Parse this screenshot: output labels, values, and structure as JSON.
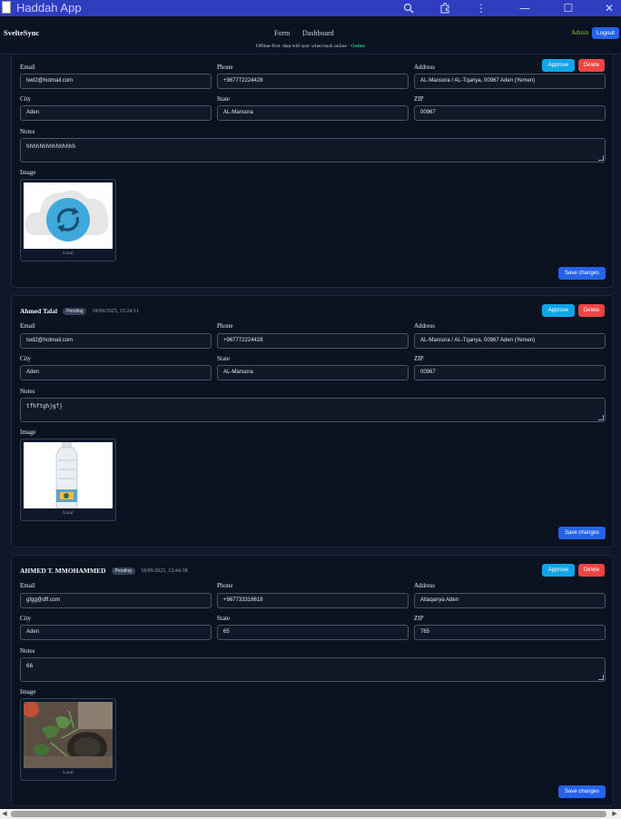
{
  "window": {
    "title": "Haddah App"
  },
  "navbar": {
    "brand": "SvelteSync",
    "links": [
      "Form",
      "Dashboard"
    ],
    "admin_label": "Admin",
    "logout_label": "Logout",
    "status_text": "Offline-first: data will sync when back online ·",
    "status_state": "Online"
  },
  "labels": {
    "email": "Email",
    "phone": "Phone",
    "address": "Address",
    "city": "City",
    "state": "State",
    "zip": "ZIP",
    "notes": "Notes",
    "image": "Image",
    "image_source": "Local",
    "approve": "Approve",
    "delete": "Delete",
    "save": "Save changes"
  },
  "records": [
    {
      "name": "",
      "badge": "",
      "date": "",
      "email": "twd2@hotmail.com",
      "phone": "+967772224428",
      "address": "AL-Mansora / AL-Tqanya, 00967 Aden (Yemen)",
      "city": "Aden",
      "state": "AL-Mansora",
      "zip": "00967",
      "notes": "hhhhhhhhhhhhhhh",
      "image": "sync-cloud-icon"
    },
    {
      "name": "Ahmed Talal",
      "badge": "Pending",
      "date": "18/09/2025, 13:24:11",
      "email": "twd2@hotmail.com",
      "phone": "+967772224428",
      "address": "AL-Mansora / AL-Tqanya, 00967 Aden (Yemen)",
      "city": "Aden",
      "state": "AL-Mansora",
      "zip": "00967",
      "notes": "tfhftghjgfj",
      "image": "water-bottle-photo"
    },
    {
      "name": "AHMED T. MMOHAMMED",
      "badge": "Pending",
      "date": "18/09/2025, 12:44:38",
      "email": "gfgg@dff.com",
      "phone": "+967733316618",
      "address": "Altaqanya Aden",
      "city": "Aden",
      "state": "65",
      "zip": "765",
      "notes": "66",
      "image": "plant-photo"
    }
  ],
  "colors": {
    "accent": "#2563eb",
    "approve": "#0ea5e9",
    "delete": "#ef4444",
    "online": "#22c55e",
    "admin": "#84cc16",
    "titlebar": "#2f3dbf"
  }
}
